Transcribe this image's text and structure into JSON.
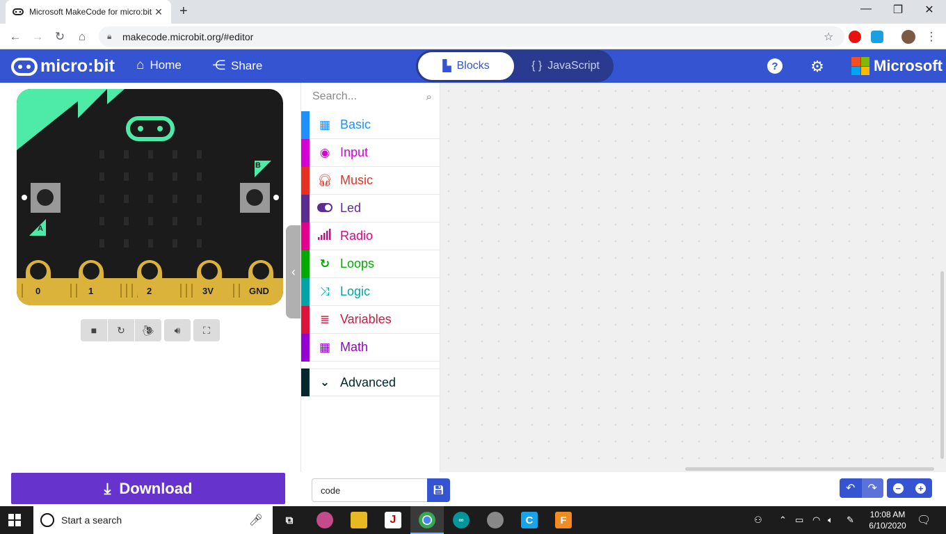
{
  "browser": {
    "tab_title": "Microsoft MakeCode for micro:bit",
    "tab_close": "✕",
    "new_tab": "+",
    "window_controls": [
      "—",
      "❐",
      "✕"
    ],
    "url": "makecode.microbit.org/#editor"
  },
  "header": {
    "logo": "micro:bit",
    "home": "Home",
    "share": "Share",
    "blocks": "Blocks",
    "javascript": "JavaScript",
    "microsoft": "Microsoft",
    "icons": [
      "help-icon",
      "gear-icon"
    ]
  },
  "simulator": {
    "button_a": "A",
    "button_b": "B",
    "pins": [
      "0",
      "1",
      "2",
      "3V",
      "GND"
    ],
    "colors": {
      "accent": "#4eeaa8",
      "board": "#1b1b1b",
      "pins": "#dbb23a"
    },
    "controls": [
      "stop-icon",
      "restart-icon",
      "slow-mo-icon",
      "mute-icon",
      "fullscreen-icon"
    ]
  },
  "toolbox": {
    "search_placeholder": "Search...",
    "categories": [
      {
        "label": "Basic",
        "color": "#1e90ff",
        "icon": "grid-icon"
      },
      {
        "label": "Input",
        "color": "#d400d4",
        "icon": "target-icon"
      },
      {
        "label": "Music",
        "color": "#e63022",
        "icon": "headphones-icon"
      },
      {
        "label": "Led",
        "color": "#5c2d91",
        "icon": "toggle-icon"
      },
      {
        "label": "Radio",
        "color": "#e3008c",
        "icon": "signal-icon"
      },
      {
        "label": "Loops",
        "color": "#00aa00",
        "icon": "loop-icon"
      },
      {
        "label": "Logic",
        "color": "#00a4a6",
        "icon": "shuffle-icon"
      },
      {
        "label": "Variables",
        "color": "#dc143c",
        "icon": "lines-icon"
      },
      {
        "label": "Math",
        "color": "#9400d3",
        "icon": "calculator-icon"
      }
    ],
    "advanced": {
      "label": "Advanced",
      "color": "#00272b"
    }
  },
  "editor": {
    "download": "Download",
    "project_name": "code"
  },
  "taskbar": {
    "search_placeholder": "Start a search",
    "time": "10:08 AM",
    "date": "6/10/2020"
  }
}
